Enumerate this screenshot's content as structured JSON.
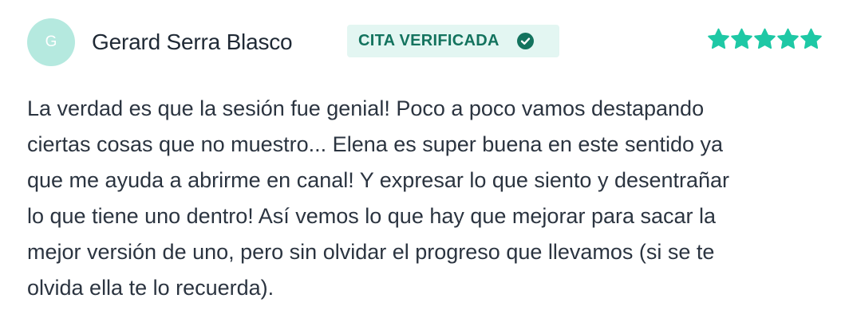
{
  "review": {
    "avatar_initial": "G",
    "author_name": "Gerard Serra Blasco",
    "badge_label": "CITA VERIFICADA",
    "badge_icon": "check-circle-icon",
    "rating": 5,
    "rating_max": 5,
    "body_lines": [
      "La verdad es que la sesión fue genial! Poco a poco vamos destapando",
      "ciertas cosas que no muestro... Elena es super buena en este sentido ya",
      "que me ayuda a abrirme en canal! Y expresar lo que siento y desentrañar",
      "lo que tiene uno dentro! Así vemos lo que hay que mejorar para sacar la",
      "mejor versión de uno, pero sin olvidar el progreso que llevamos (si se te",
      "olvida ella te lo recuerda)."
    ]
  },
  "colors": {
    "avatar_bg": "#b5e9df",
    "badge_bg": "#e3f6f2",
    "badge_text": "#13735e",
    "star": "#1ec8a5",
    "text": "#2b3440"
  }
}
